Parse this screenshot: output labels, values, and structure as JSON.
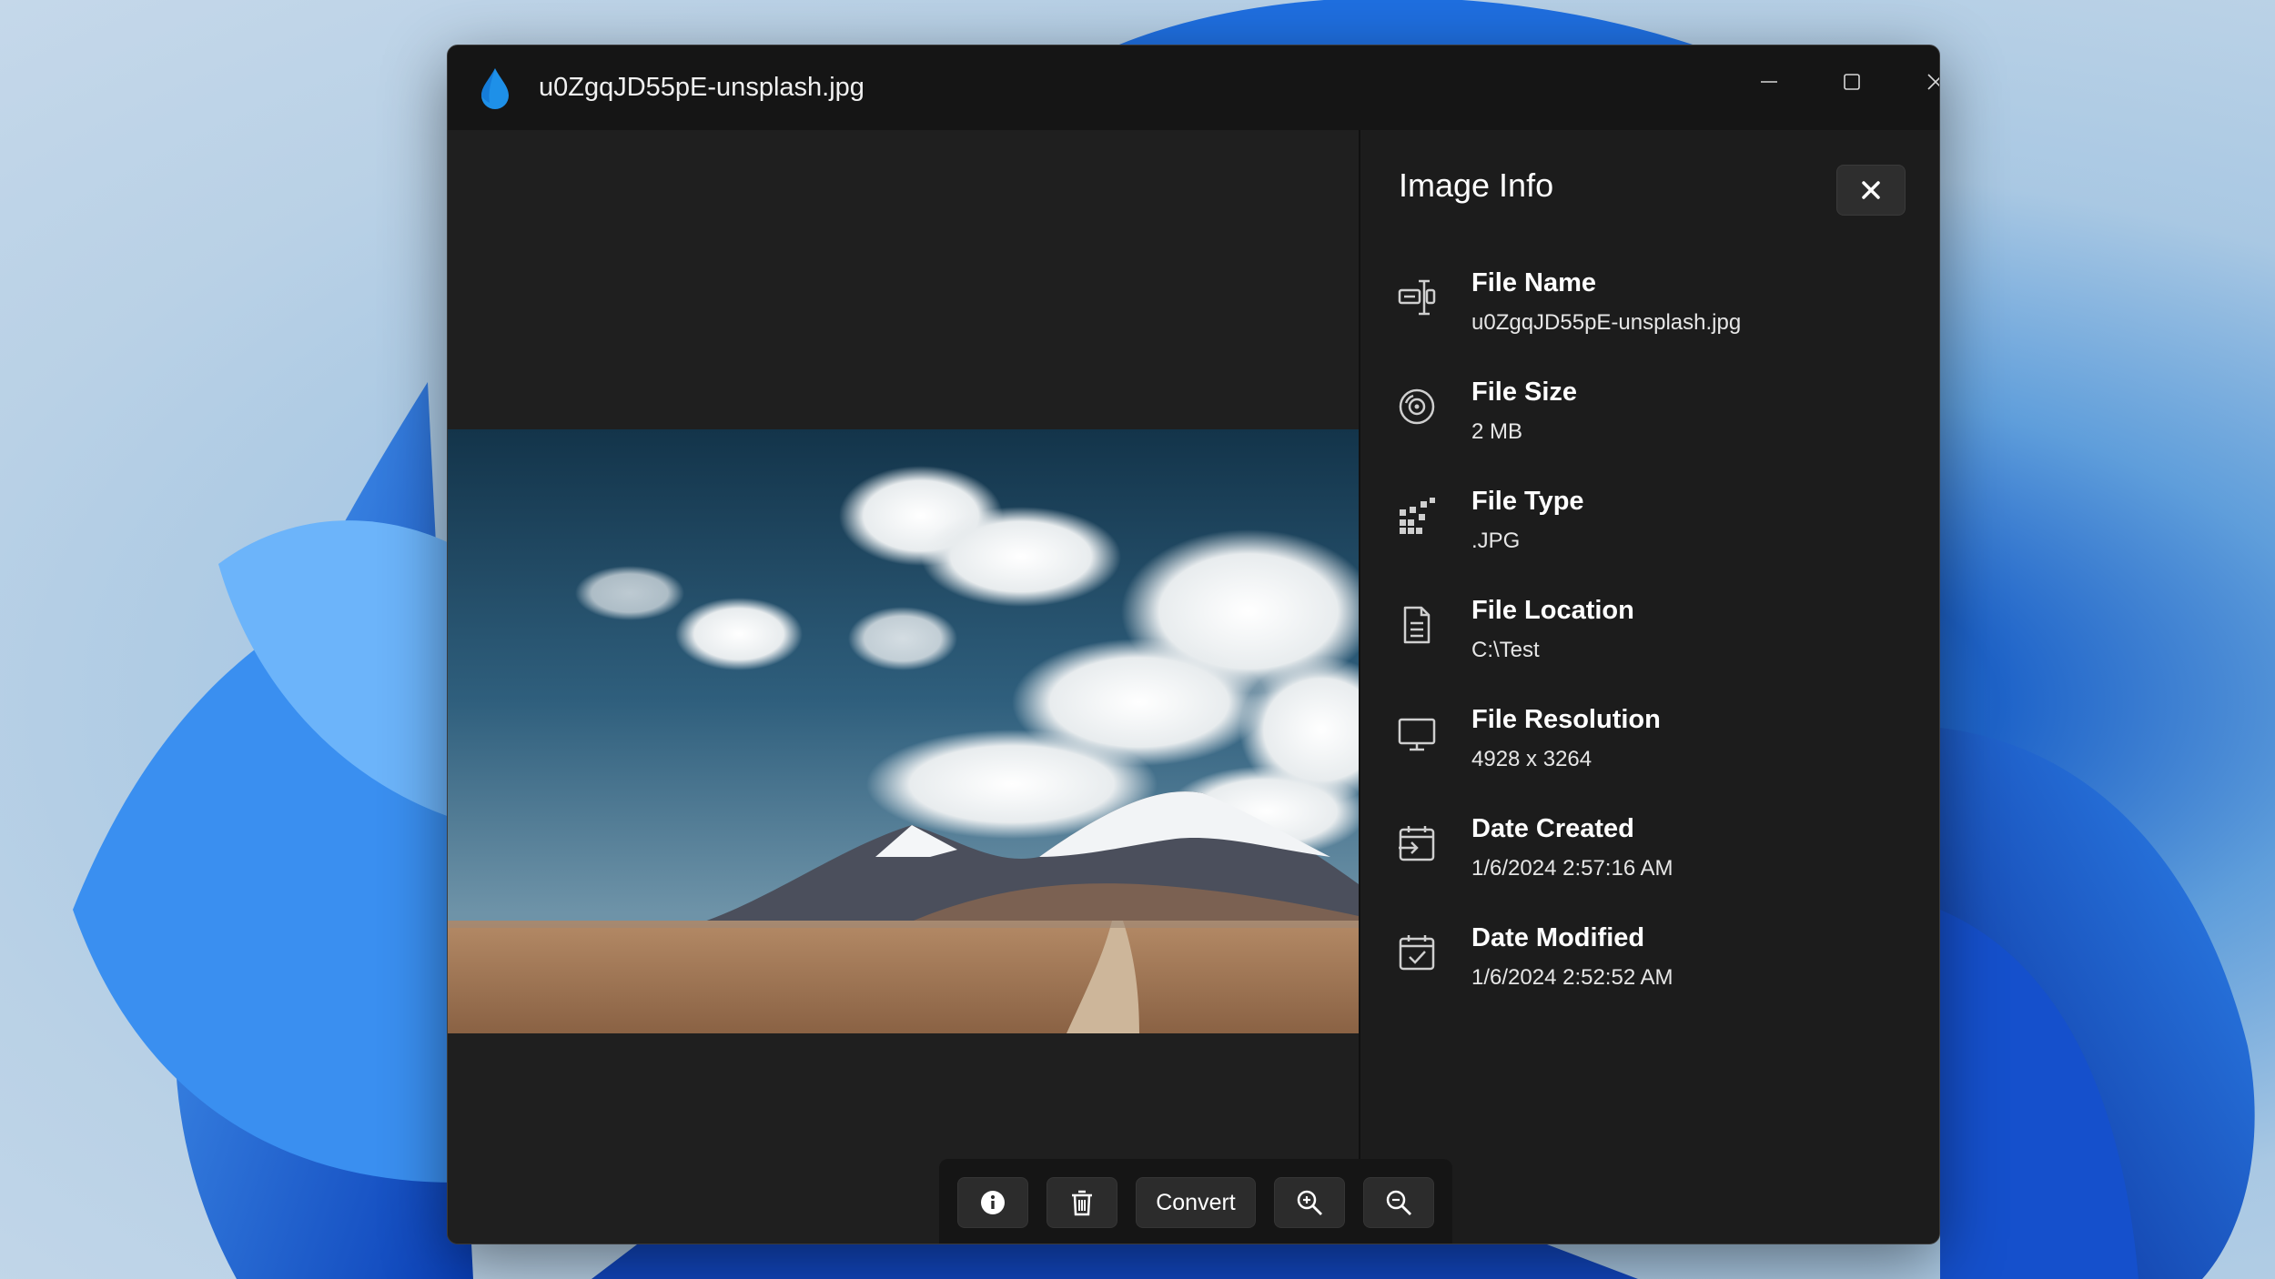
{
  "window": {
    "title": "u0ZgqJD55pE-unsplash.jpg",
    "app_icon": "water-drop-icon",
    "caption_buttons": [
      "minimize-icon",
      "maximize-icon",
      "close-icon"
    ]
  },
  "info_panel": {
    "title": "Image Info",
    "close_icon": "close-icon",
    "rows": [
      {
        "icon": "file-name-icon",
        "label": "File Name",
        "value": "u0ZgqJD55pE-unsplash.jpg"
      },
      {
        "icon": "disc-icon",
        "label": "File Size",
        "value": "2 MB"
      },
      {
        "icon": "file-type-icon",
        "label": "File Type",
        "value": ".JPG"
      },
      {
        "icon": "document-icon",
        "label": "File Location",
        "value": "C:\\Test"
      },
      {
        "icon": "monitor-icon",
        "label": "File Resolution",
        "value": "4928 x 3264"
      },
      {
        "icon": "calendar-import-icon",
        "label": "Date Created",
        "value": "1/6/2024 2:57:16 AM"
      },
      {
        "icon": "calendar-check-icon",
        "label": "Date Modified",
        "value": "1/6/2024 2:52:52 AM"
      }
    ]
  },
  "toolbar": {
    "info_icon": "info-icon",
    "delete_icon": "trash-icon",
    "convert_label": "Convert",
    "zoom_in_icon": "zoom-in-icon",
    "zoom_out_icon": "zoom-out-icon"
  },
  "colors": {
    "window_bg": "#202020",
    "titlebar_bg": "#151515",
    "accent": "#1e90e8"
  }
}
